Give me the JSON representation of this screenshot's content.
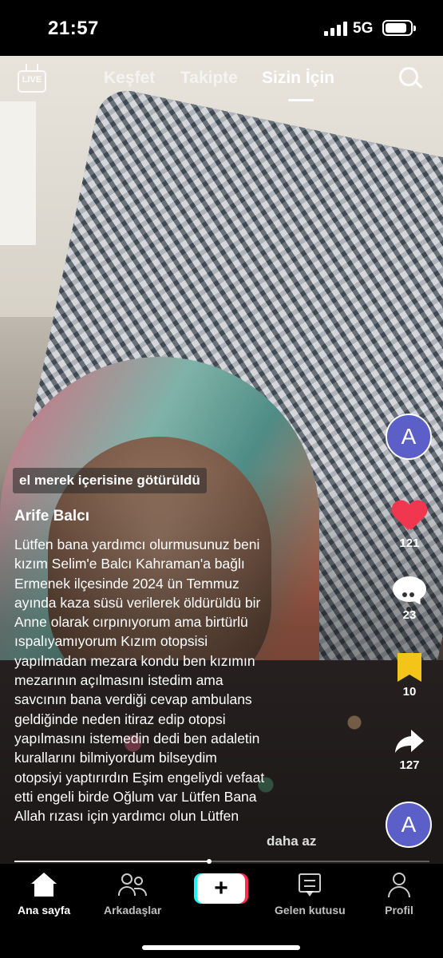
{
  "status_bar": {
    "time": "21:57",
    "network": "5G"
  },
  "top_nav": {
    "live_label": "LIVE",
    "tabs": [
      {
        "label": "Keşfet"
      },
      {
        "label": "Takipte"
      },
      {
        "label": "Sizin İçin",
        "active": true
      }
    ]
  },
  "rail": {
    "avatar_letter": "A",
    "likes": "121",
    "comments": "23",
    "saves": "10",
    "shares": "127",
    "sound_avatar_letter": "A"
  },
  "post": {
    "location": "el merek içerisine götürüldü",
    "author": "Arife Balcı",
    "caption": "Lütfen bana yardımcı olurmusunuz beni\nkızım Selim'e Balcı Kahraman'a bağlı\nErmenek ilçesinde 2024 ün Temmuz\nayında  kaza süsü verilerek öldürüldü bir\nAnne olarak cırpınıyorum ama birtürlü\nıspalıyamıyorum Kızım otopsisi\nyapılmadan mezara kondu ben kızımın\nmezarının açılmasını istedim ama\nsavcının bana verdiği cevap ambulans\ngeldiğinde neden itiraz edip otopsi\nyapılmasını istemedin dedi ben adaletin\nkurallarını bilmiyordum bilseydim\notopsiyi yaptırırdın Eşim engeliydi vefaat\netti engeli birde Oğlum var Lütfen Bana\nAllah rızası için yardımcı olun Lütfen",
    "less_label": "daha az",
    "progress": 0.47
  },
  "bottom_nav": {
    "items": [
      {
        "label": "Ana sayfa",
        "active": true
      },
      {
        "label": "Arkadaşlar"
      },
      {
        "label": "+"
      },
      {
        "label": "Gelen kutusu"
      },
      {
        "label": "Profil"
      }
    ]
  },
  "colors": {
    "like": "#f1364f",
    "save": "#f5c419",
    "avatar": "#5b5fc7"
  }
}
